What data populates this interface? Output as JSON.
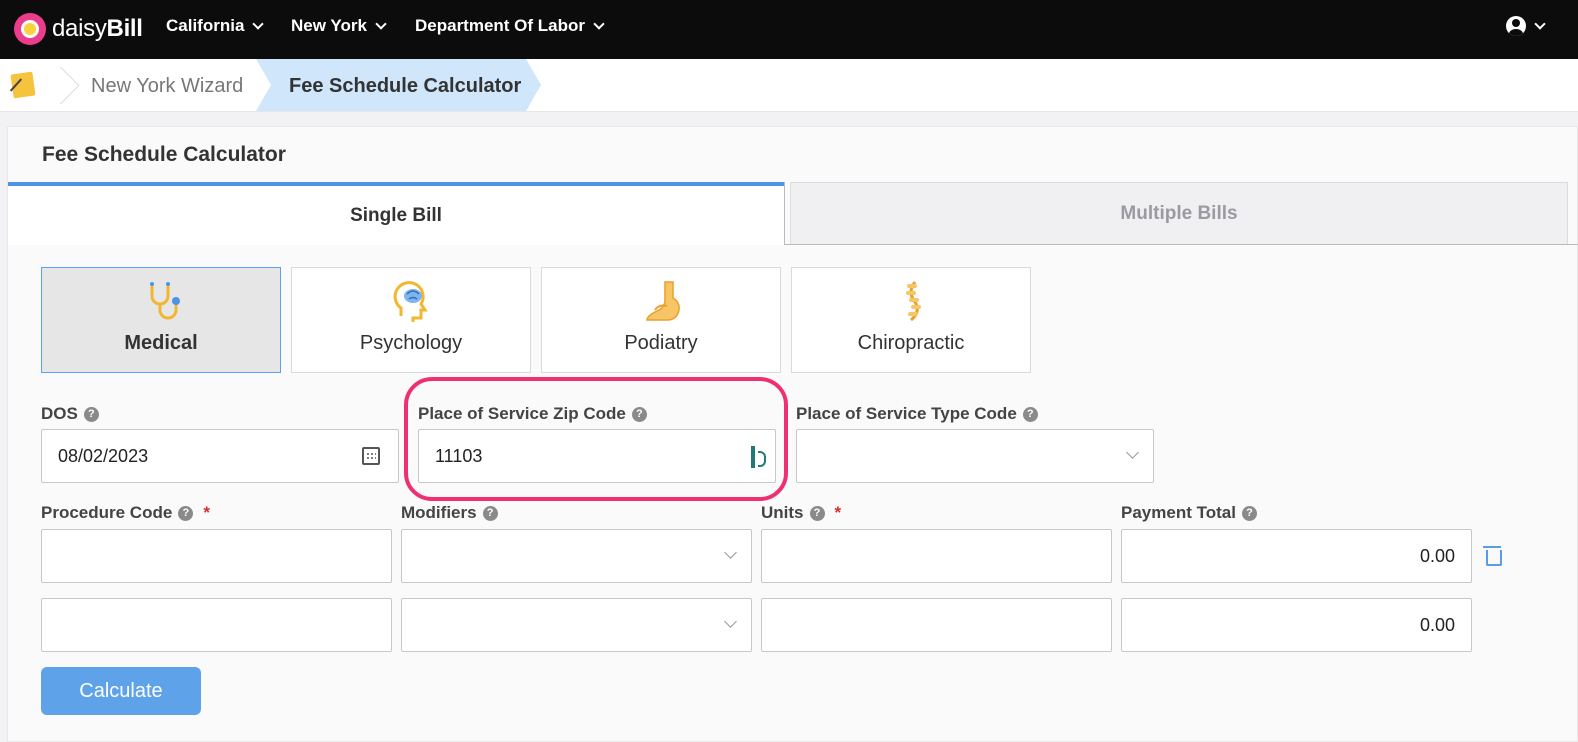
{
  "brand": {
    "name_light": "daisy",
    "name_bold": "Bill"
  },
  "nav": {
    "items": [
      {
        "label": "California"
      },
      {
        "label": "New York"
      },
      {
        "label": "Department Of Labor"
      }
    ]
  },
  "breadcrumb": {
    "items": [
      {
        "label": "New York Wizard"
      },
      {
        "label": "Fee Schedule Calculator"
      }
    ]
  },
  "card": {
    "title": "Fee Schedule Calculator"
  },
  "tabs": [
    {
      "label": "Single Bill",
      "active": true
    },
    {
      "label": "Multiple Bills",
      "active": false
    }
  ],
  "bill_types": [
    {
      "label": "Medical",
      "icon": "stethoscope-icon",
      "selected": true
    },
    {
      "label": "Psychology",
      "icon": "brain-icon",
      "selected": false
    },
    {
      "label": "Podiatry",
      "icon": "foot-icon",
      "selected": false
    },
    {
      "label": "Chiropractic",
      "icon": "spine-icon",
      "selected": false
    }
  ],
  "fields": {
    "dos": {
      "label": "DOS",
      "value": "08/02/2023"
    },
    "zip": {
      "label": "Place of Service Zip Code",
      "value": "11103"
    },
    "pos_type": {
      "label": "Place of Service Type Code",
      "value": ""
    }
  },
  "line_headers": {
    "procedure": "Procedure Code",
    "modifiers": "Modifiers",
    "units": "Units",
    "payment": "Payment Total",
    "required_mark": "*"
  },
  "lines": [
    {
      "procedure": "",
      "modifiers": "",
      "units": "",
      "payment": "0.00"
    },
    {
      "procedure": "",
      "modifiers": "",
      "units": "",
      "payment": "0.00"
    }
  ],
  "actions": {
    "calculate": "Calculate"
  },
  "colors": {
    "accent": "#5ea2ea",
    "highlight": "#ef2f72",
    "brand_pink": "#ec3d8c"
  }
}
